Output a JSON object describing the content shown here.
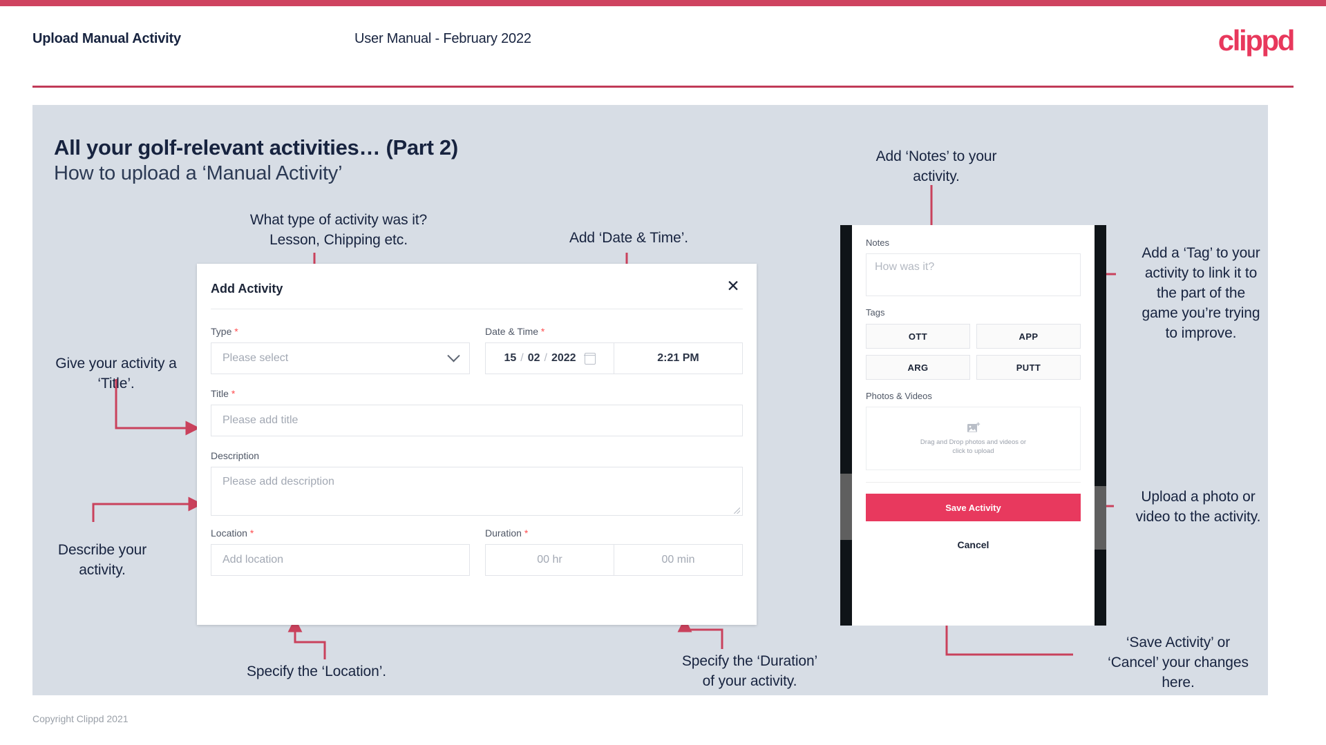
{
  "header": {
    "title": "Upload Manual Activity",
    "subtitle": "User Manual - February 2022",
    "logo": "clippd"
  },
  "slide": {
    "heading": "All your golf-relevant activities… (Part 2)",
    "subheading": "How to upload a ‘Manual Activity’"
  },
  "annotations": {
    "type": "What type of activity was it?\nLesson, Chipping etc.",
    "datetime": "Add ‘Date & Time’.",
    "title": "Give your activity a\n‘Title’.",
    "description": "Describe your\nactivity.",
    "location": "Specify the ‘Location’.",
    "duration": "Specify the ‘Duration’\nof your activity.",
    "notes": "Add ‘Notes’ to your\nactivity.",
    "tags": "Add a ‘Tag’ to your\nactivity to link it to\nthe part of the\ngame you’re trying\nto improve.",
    "photos": "Upload a photo or\nvideo to the activity.",
    "save": "‘Save Activity’ or\n‘Cancel’ your changes\nhere."
  },
  "dialog": {
    "title": "Add Activity",
    "close_icon": "close-icon",
    "fields": {
      "type": {
        "label": "Type",
        "required": "*",
        "placeholder": "Please select",
        "chevron_icon": "chevron-down-icon"
      },
      "datetime": {
        "label": "Date & Time",
        "required": "*",
        "day": "15",
        "sep1": "/",
        "month": "02",
        "sep2": "/",
        "year": "2022",
        "calendar_icon": "calendar-icon",
        "time": "2:21 PM"
      },
      "title": {
        "label": "Title",
        "required": "*",
        "placeholder": "Please add title"
      },
      "description": {
        "label": "Description",
        "placeholder": "Please add description"
      },
      "location": {
        "label": "Location",
        "required": "*",
        "placeholder": "Add location"
      },
      "duration": {
        "label": "Duration",
        "required": "*",
        "hours": "00 hr",
        "minutes": "00 min"
      }
    }
  },
  "phone": {
    "notes": {
      "label": "Notes",
      "placeholder": "How was it?"
    },
    "tags": {
      "label": "Tags",
      "items": [
        "OTT",
        "APP",
        "ARG",
        "PUTT"
      ]
    },
    "photos": {
      "label": "Photos & Videos",
      "icon": "image-add-icon",
      "caption_line1": "Drag and Drop photos and videos or",
      "caption_line2": "click to upload"
    },
    "save_label": "Save Activity",
    "cancel_label": "Cancel"
  },
  "footer": {
    "copyright": "Copyright Clippd 2021"
  },
  "colors": {
    "brand_pink": "#e8385c",
    "rule_red": "#c13a58",
    "arrow_red": "#c9415c",
    "panel_bg": "#d7dde5",
    "text_dark": "#17233f"
  }
}
